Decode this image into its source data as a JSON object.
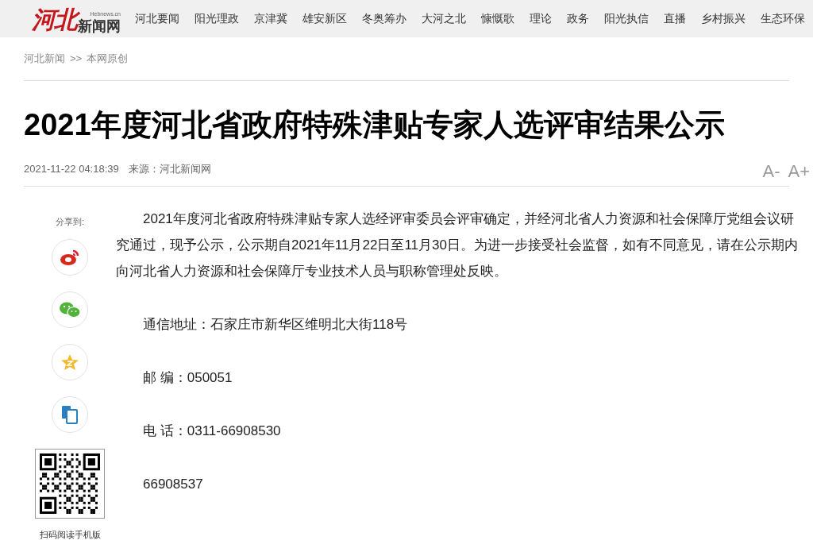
{
  "logo": {
    "mark": "河北",
    "domain": "Hebnews.cn",
    "name": "新闻网"
  },
  "nav": [
    {
      "label": "河北要闻"
    },
    {
      "label": "阳光理政"
    },
    {
      "label": "京津冀"
    },
    {
      "label": "雄安新区"
    },
    {
      "label": "冬奥筹办"
    },
    {
      "label": "大河之北"
    },
    {
      "label": "慷慨歌"
    },
    {
      "label": "理论"
    },
    {
      "label": "政务"
    },
    {
      "label": "阳光执信"
    },
    {
      "label": "直播"
    },
    {
      "label": "乡村振兴"
    },
    {
      "label": "生态环保"
    }
  ],
  "breadcrumb": {
    "section": "河北新闻",
    "separator": ">>",
    "current": "本网原创"
  },
  "article": {
    "title": "2021年度河北省政府特殊津贴专家人选评审结果公示",
    "time": "2021-11-22 04:18:39",
    "source": "来源：河北新闻网",
    "font_smaller": "A-",
    "font_larger": "A+",
    "paragraphs": [
      "2021年度河北省政府特殊津贴专家人选经评审委员会评审确定，并经河北省人力资源和社会保障厅党组会议研究通过，现予公示，公示期自2021年11月22日至11月30日。为进一步接受社会监督，如有不同意见，请在公示期内向河北省人力资源和社会保障厅专业技术人员与职称管理处反映。",
      "通信地址：石家庄市新华区维明北大街118号",
      "邮 编：050051",
      "电 话：0311-66908530",
      "66908537"
    ]
  },
  "share": {
    "label": "分享到:",
    "buttons": [
      {
        "kind": "weibo"
      },
      {
        "kind": "wechat"
      },
      {
        "kind": "qzone"
      },
      {
        "kind": "mobile"
      }
    ],
    "qr_caption": "扫码阅读手机版"
  }
}
